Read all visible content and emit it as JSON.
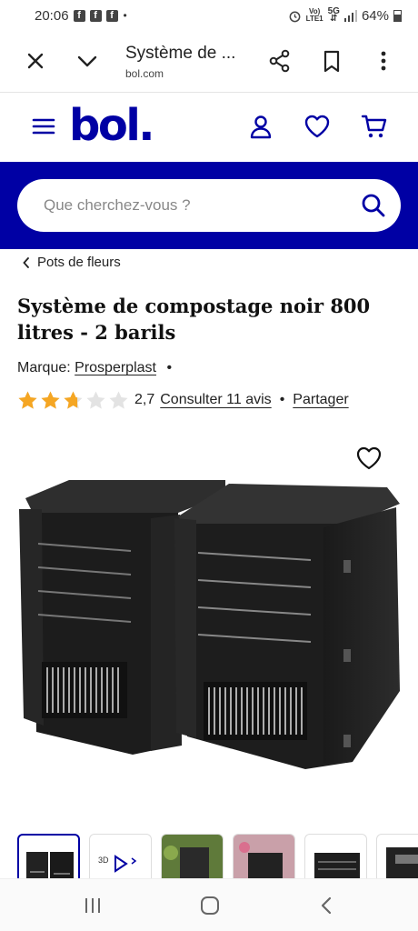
{
  "status_bar": {
    "time": "20:06",
    "notification_icons": [
      "facebook-icon",
      "facebook-icon",
      "facebook-icon"
    ],
    "more_dot": "•",
    "network_label_top": "Vo)",
    "network_label_bottom": "LTE1",
    "network_type": "5G",
    "battery_percent": "64%"
  },
  "browser_bar": {
    "page_title": "Système de ...",
    "url": "bol.com"
  },
  "site_header": {
    "logo_text": "bol."
  },
  "search": {
    "placeholder": "Que cherchez-vous ?"
  },
  "breadcrumb": {
    "label": "Pots de fleurs"
  },
  "product": {
    "title": "Système de compostage noir 800 litres - 2 barils",
    "brand_label": "Marque:",
    "brand_name": "Prosperplast",
    "brand_separator": "•",
    "rating_value": "2,7",
    "rating_fraction": 0.54,
    "reviews_link": "Consulter 11 avis",
    "rating_separator": "•",
    "share_link": "Partager"
  },
  "colors": {
    "brand_blue": "#0000a4",
    "star_fill": "#f5a623",
    "star_empty": "#e3e3e3"
  },
  "thumbnails": [
    {
      "name": "thumb-composter",
      "active": true
    },
    {
      "name": "thumb-video",
      "active": false
    },
    {
      "name": "thumb-garden",
      "active": false
    },
    {
      "name": "thumb-flowers",
      "active": false
    },
    {
      "name": "thumb-composter-2",
      "active": false
    },
    {
      "name": "thumb-composter-3",
      "active": false
    }
  ],
  "thumb_video_text": "3D"
}
